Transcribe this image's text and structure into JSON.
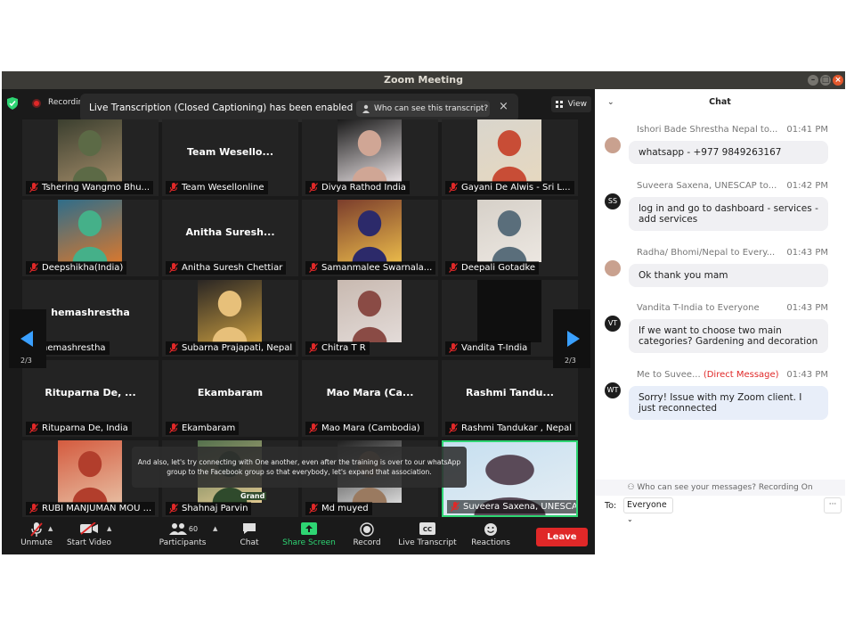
{
  "window": {
    "title": "Zoom Meeting",
    "colors": {
      "titlebar": "#3c3b37",
      "meeting_bg": "#1a1a1a"
    }
  },
  "topbar": {
    "recording_label": "Recording",
    "notice_text": "Live Transcription (Closed Captioning) has been enabled",
    "notice_who_label": "Who can see this transcript?",
    "view_label": "View"
  },
  "tiles": [
    {
      "display": "",
      "label": "Tshering Wangmo Bhu...",
      "photo_colors": [
        "#3b3f2f",
        "#a08967",
        "#5c6a46"
      ]
    },
    {
      "display": "Team Wesello...",
      "label": "Team Wesellonline"
    },
    {
      "display": "",
      "label": "Divya Rathod India",
      "photo_colors": [
        "#1a1a1a",
        "#e9e2e4",
        "#d0a695"
      ]
    },
    {
      "display": "",
      "label": "Gayani De Alwis - Sri L...",
      "photo_colors": [
        "#d9d5cc",
        "#e6d8c0",
        "#c84d36"
      ]
    },
    {
      "display": "",
      "label": "Deepshikha(India)",
      "photo_colors": [
        "#2f6d8a",
        "#d7782f",
        "#45b089"
      ]
    },
    {
      "display": "Anitha Suresh...",
      "label": "Anitha Suresh Chettiar"
    },
    {
      "display": "",
      "label": "Samanmalee Swarnala...",
      "photo_colors": [
        "#7b3d2c",
        "#e9b94a",
        "#2c2a6a"
      ]
    },
    {
      "display": "",
      "label": "Deepali Gotadke",
      "photo_colors": [
        "#d6d0c8",
        "#ece7e1",
        "#5a6e7b"
      ]
    },
    {
      "display": "hemashrestha",
      "label": "hemashrestha"
    },
    {
      "display": "",
      "label": "Subarna Prajapati, Nepal",
      "photo_colors": [
        "#2a2624",
        "#c59a3f",
        "#e7c07a"
      ]
    },
    {
      "display": "",
      "label": "Chitra T R",
      "photo_colors": [
        "#c8b9b0",
        "#e3dbd8",
        "#8a4b45"
      ]
    },
    {
      "display": "",
      "label": "Vandita T-India",
      "photo_colors": [
        "#0f0f0f",
        "#0f0f0f",
        "#0f0f0f"
      ]
    },
    {
      "display": "Rituparna De, ...",
      "label": "Rituparna De, India"
    },
    {
      "display": "Ekambaram",
      "label": "Ekambaram"
    },
    {
      "display": "Mao Mara (Ca...",
      "label": "Mao Mara (Cambodia)"
    },
    {
      "display": "Rashmi Tandu...",
      "label": "Rashmi Tandukar , Nepal"
    },
    {
      "display": "",
      "label": "RUBI MANJUMAN MOU ...",
      "photo_colors": [
        "#d45b3f",
        "#e7bb9f",
        "#b23e2c"
      ]
    },
    {
      "display": "",
      "label": "Shahnaj Parvin",
      "photo_colors": [
        "#536f4c",
        "#e0c890",
        "#2f4a2c"
      ],
      "sign_text": "Grand"
    },
    {
      "display": "",
      "label": "Md muyed",
      "photo_colors": [
        "#202020",
        "#d8d8d8",
        "#9a7a60"
      ]
    },
    {
      "display": "",
      "label": "Suveera Saxena, UNESCAP",
      "photo_colors": [
        "#c6dff0",
        "#e6eef4",
        "#5a4a58"
      ],
      "active": true
    }
  ],
  "pager": {
    "left_label": "2/3",
    "right_label": "2/3"
  },
  "caption_text": "And also, let's try connecting with One another, even after the training is over to our whatsApp group to the Facebook group so that everybody, let's expand that association.",
  "toolbar": {
    "unmute": "Unmute",
    "start_video": "Start Video",
    "participants": "Participants",
    "participants_count": "60",
    "chat": "Chat",
    "share_screen": "Share Screen",
    "record": "Record",
    "live_transcript": "Live Transcript",
    "reactions": "Reactions",
    "leave": "Leave",
    "colors": {
      "share": "#2ed573",
      "leave": "#e02828"
    }
  },
  "chat": {
    "title": "Chat",
    "messages": [
      {
        "sender": "Ishori Bade Shrestha Nepal to...",
        "time": "01:41 PM",
        "text": "whatsapp - +977 9849263167",
        "avatar": ""
      },
      {
        "sender": "Suveera Saxena, UNESCAP to...",
        "time": "01:42 PM",
        "text": "log in and go to dashboard - services - add services",
        "avatar": "SS"
      },
      {
        "sender": "Radha/ Bhomi/Nepal to Every...",
        "time": "01:43 PM",
        "text": "Ok thank you mam",
        "avatar": ""
      },
      {
        "sender": "Vandita T-India to Everyone",
        "time": "01:43 PM",
        "text": "If we want to choose two main categories? Gardening and decoration",
        "avatar": "VT"
      },
      {
        "sender": "Me to Suvee...",
        "dm_label": "(Direct Message)",
        "time": "01:43 PM",
        "text": "Sorry! Issue with my Zoom client. I just reconnected",
        "avatar": "WT"
      }
    ],
    "who_can_see": "Who can see your messages? Recording On",
    "to_label": "To:",
    "to_value": "Everyone",
    "more_label": "···"
  }
}
